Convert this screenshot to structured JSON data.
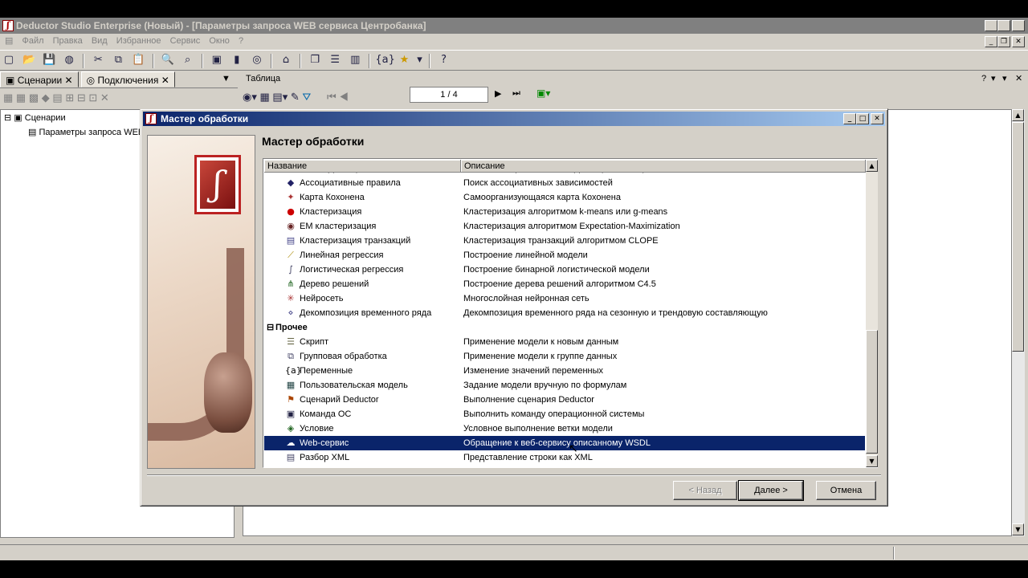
{
  "window": {
    "title": "Deductor Studio Enterprise (Новый) - [Параметры запроса WEB сервиса Центробанка]"
  },
  "menu": [
    "Файл",
    "Правка",
    "Вид",
    "Избранное",
    "Сервис",
    "Окно",
    "?"
  ],
  "left_panel": {
    "tabs": [
      "Сценарии",
      "Подключения"
    ],
    "tree": {
      "root": "Сценарии",
      "child": "Параметры запроса WEB"
    }
  },
  "right_panel": {
    "title": "Таблица",
    "pager": "1 / 4",
    "help": "?"
  },
  "dialog": {
    "title": "Мастер обработки",
    "heading": "Мастер обработки",
    "columns": [
      "Название",
      "Описание"
    ],
    "rows": [
      {
        "icon": "autocorrelation-icon",
        "glyph": "∿",
        "name": "Автокорреляция",
        "desc": "Расчет выборочной автокорреляции столбцов"
      },
      {
        "icon": "association-rules-icon",
        "glyph": "◆",
        "name": "Ассоциативные правила",
        "desc": "Поиск ассоциативных зависимостей"
      },
      {
        "icon": "kohonen-map-icon",
        "glyph": "✦",
        "name": "Карта Кохонена",
        "desc": "Самоорганизующаяся карта Кохонена"
      },
      {
        "icon": "clustering-icon",
        "glyph": "●",
        "name": "Кластеризация",
        "desc": "Кластеризация алгоритмом k-means или g-means"
      },
      {
        "icon": "em-clustering-icon",
        "glyph": "◉",
        "name": "ЕМ кластеризация",
        "desc": "Кластеризация алгоритмом Expectation-Maximization"
      },
      {
        "icon": "transaction-clustering-icon",
        "glyph": "▤",
        "name": "Кластеризация транзакций",
        "desc": "Кластеризация транзакций алгоритмом CLOPE"
      },
      {
        "icon": "linear-regression-icon",
        "glyph": "⟋",
        "name": "Линейная регрессия",
        "desc": "Построение линейной модели"
      },
      {
        "icon": "logistic-regression-icon",
        "glyph": "∫",
        "name": "Логистическая регрессия",
        "desc": "Построение бинарной логистической модели"
      },
      {
        "icon": "decision-tree-icon",
        "glyph": "⋔",
        "name": "Дерево решений",
        "desc": "Построение дерева решений алгоритмом С4.5"
      },
      {
        "icon": "neural-network-icon",
        "glyph": "✳",
        "name": "Нейросеть",
        "desc": "Многослойная нейронная сеть"
      },
      {
        "icon": "time-series-decomposition-icon",
        "glyph": "⋄",
        "name": "Декомпозиция временного ряда",
        "desc": "Декомпозиция временного ряда на сезонную и трендовую составляющую"
      },
      {
        "group": true,
        "name": "Прочее"
      },
      {
        "icon": "script-icon",
        "glyph": "☰",
        "name": "Скрипт",
        "desc": "Применение модели к новым данным"
      },
      {
        "icon": "batch-processing-icon",
        "glyph": "⧉",
        "name": "Групповая обработка",
        "desc": "Применение модели к группе данных"
      },
      {
        "icon": "variables-icon",
        "glyph": "{a}",
        "name": "Переменные",
        "desc": "Изменение значений переменных"
      },
      {
        "icon": "user-model-icon",
        "glyph": "▦",
        "name": "Пользовательская модель",
        "desc": "Задание модели вручную по формулам"
      },
      {
        "icon": "deductor-scenario-icon",
        "glyph": "⚑",
        "name": "Сценарий Deductor",
        "desc": "Выполнение сценария Deductor"
      },
      {
        "icon": "os-command-icon",
        "glyph": "▣",
        "name": "Команда ОС",
        "desc": "Выполнить команду операционной системы"
      },
      {
        "icon": "condition-icon",
        "glyph": "◈",
        "name": "Условие",
        "desc": "Условное выполнение ветки модели"
      },
      {
        "icon": "web-service-icon",
        "glyph": "☁",
        "name": "Web-сервис",
        "desc": "Обращение к веб-сервису описанному WSDL",
        "selected": true
      },
      {
        "icon": "xml-parse-icon",
        "glyph": "▤",
        "name": "Разбор XML",
        "desc": "Представление строки как XML"
      }
    ],
    "buttons": {
      "back": "< Назад",
      "next": "Далее >",
      "cancel": "Отмена"
    }
  }
}
